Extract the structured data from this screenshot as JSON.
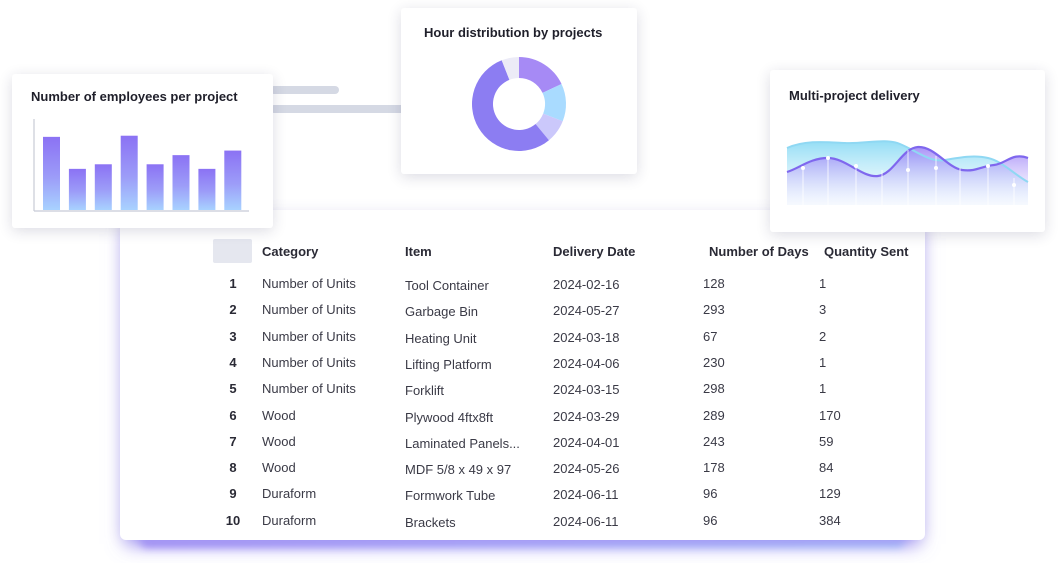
{
  "cards": {
    "employees": {
      "title": "Number of employees per project",
      "chart_data": {
        "type": "bar",
        "values": [
          64,
          36,
          40,
          65,
          40,
          48,
          36,
          52
        ]
      }
    },
    "hours": {
      "title": "Hour distribution by projects",
      "chart_data": {
        "type": "pie",
        "values": [
          18,
          13,
          8,
          55,
          6
        ]
      }
    },
    "delivery": {
      "title": "Multi-project delivery"
    }
  },
  "table": {
    "headers": [
      "Category",
      "Item",
      "Delivery Date",
      "Number of Days",
      "Quantity Sent"
    ],
    "rows": [
      {
        "num": "1",
        "category": "Number of Units",
        "item": "Tool Container",
        "date": "2024-02-16",
        "days": "128",
        "qty": "1"
      },
      {
        "num": "2",
        "category": "Number of Units",
        "item": "Garbage Bin",
        "date": "2024-05-27",
        "days": "293",
        "qty": "3"
      },
      {
        "num": "3",
        "category": "Number of Units",
        "item": "Heating Unit",
        "date": "2024-03-18",
        "days": "67",
        "qty": "2"
      },
      {
        "num": "4",
        "category": "Number of Units",
        "item": "Lifting Platform",
        "date": "2024-04-06",
        "days": "230",
        "qty": "1"
      },
      {
        "num": "5",
        "category": "Number of Units",
        "item": "Forklift",
        "date": "2024-03-15",
        "days": "298",
        "qty": "1"
      },
      {
        "num": "6",
        "category": "Wood",
        "item": "Plywood 4ftx8ft",
        "date": "2024-03-29",
        "days": "289",
        "qty": "170"
      },
      {
        "num": "7",
        "category": "Wood",
        "item": "Laminated Panels...",
        "date": "2024-04-01",
        "days": "243",
        "qty": "59"
      },
      {
        "num": "8",
        "category": "Wood",
        "item": "MDF 5/8 x 49 x 97",
        "date": "2024-05-26",
        "days": "178",
        "qty": "84"
      },
      {
        "num": "9",
        "category": "Duraform",
        "item": "Formwork Tube",
        "date": "2024-06-11",
        "days": "96",
        "qty": "129"
      },
      {
        "num": "10",
        "category": "Duraform",
        "item": "Brackets",
        "date": "2024-06-11",
        "days": "96",
        "qty": "384"
      }
    ]
  },
  "colors": {
    "accent": "#8b74f5",
    "accent_light": "#a9c8ff",
    "teal": "#9fe3f5"
  }
}
